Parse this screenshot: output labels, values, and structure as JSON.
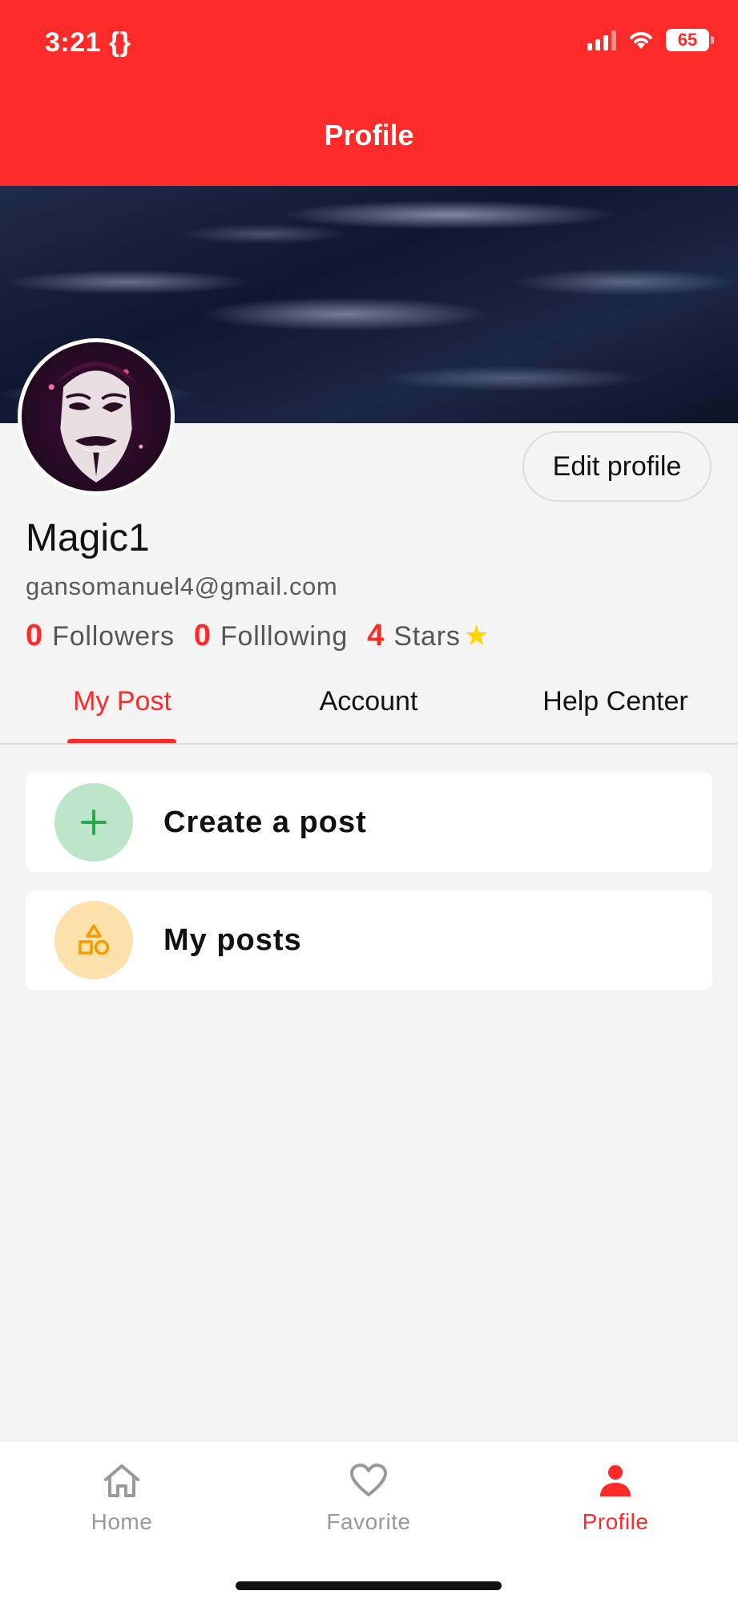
{
  "status_bar": {
    "time": "3:21 {}",
    "battery": "65"
  },
  "header": {
    "title": "Profile"
  },
  "profile": {
    "name": "Magic1",
    "email": "gansomanuel4@gmail.com",
    "edit_button": "Edit profile",
    "stats": {
      "followers": {
        "count": "0",
        "label": "Followers"
      },
      "following": {
        "count": "0",
        "label": "Folllowing"
      },
      "stars": {
        "count": "4",
        "label": "Stars"
      }
    }
  },
  "tabs": [
    {
      "label": "My Post",
      "active": true
    },
    {
      "label": "Account",
      "active": false
    },
    {
      "label": "Help Center",
      "active": false
    }
  ],
  "cards": [
    {
      "label": "Create a post",
      "icon": "plus-icon",
      "icon_bg": "#bde6c8",
      "icon_color": "#2aa84a"
    },
    {
      "label": "My posts",
      "icon": "shapes-icon",
      "icon_bg": "#fde1ab",
      "icon_color": "#f59a00"
    }
  ],
  "bottom_nav": [
    {
      "label": "Home",
      "icon": "home-icon",
      "active": false
    },
    {
      "label": "Favorite",
      "icon": "heart-icon",
      "active": false
    },
    {
      "label": "Profile",
      "icon": "person-icon",
      "active": true
    }
  ],
  "colors": {
    "accent": "#fc2b2a",
    "star": "#ffd400",
    "background": "#f4f4f4"
  }
}
